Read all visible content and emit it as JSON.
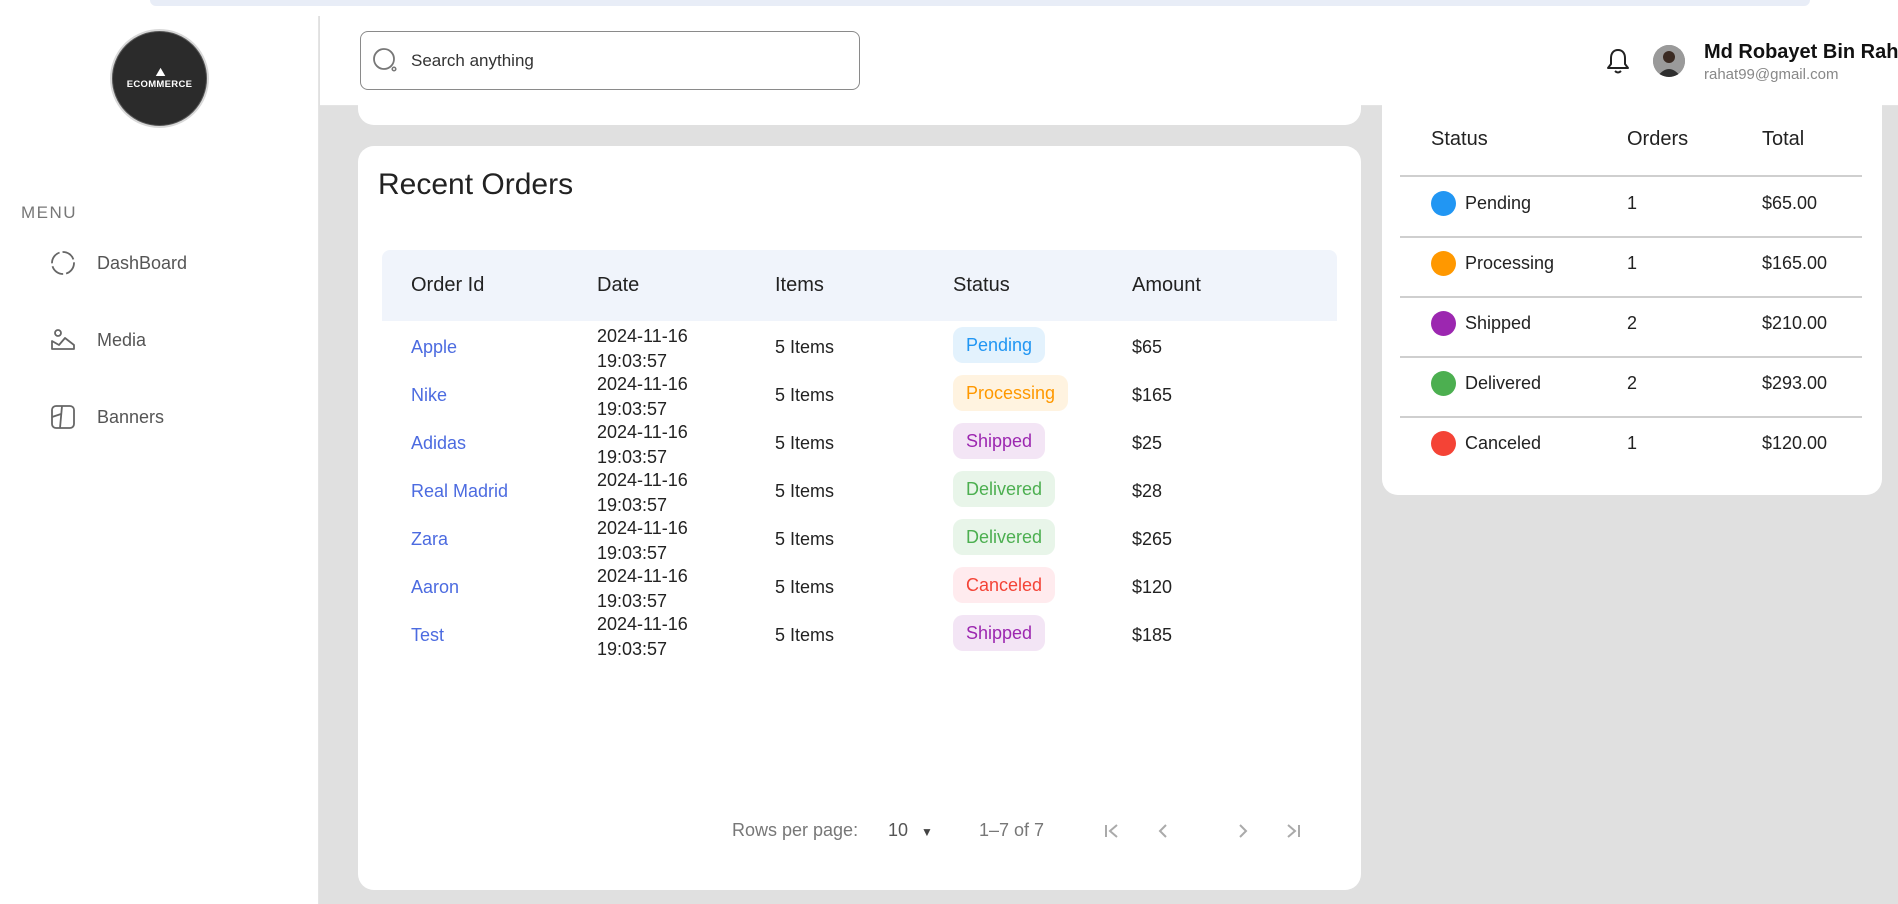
{
  "app": {
    "logo_text": "ECOMMERCE"
  },
  "sidebar": {
    "menu_title": "MENU",
    "items": [
      {
        "label": "DashBoard",
        "icon": "dashboard-icon"
      },
      {
        "label": "Media",
        "icon": "media-icon"
      },
      {
        "label": "Banners",
        "icon": "banners-icon"
      }
    ]
  },
  "header": {
    "search_placeholder": "Search anything",
    "user_name": "Md Robayet Bin Rahat",
    "user_email": "rahat99@gmail.com"
  },
  "recent_orders": {
    "title": "Recent Orders",
    "columns": [
      "Order Id",
      "Date",
      "Items",
      "Status",
      "Amount"
    ],
    "rows": [
      {
        "order_id": "Apple",
        "date": "2024-11-16",
        "time": "19:03:57",
        "items": "5 Items",
        "status": "Pending",
        "amount": "$65"
      },
      {
        "order_id": "Nike",
        "date": "2024-11-16",
        "time": "19:03:57",
        "items": "5 Items",
        "status": "Processing",
        "amount": "$165"
      },
      {
        "order_id": "Adidas",
        "date": "2024-11-16",
        "time": "19:03:57",
        "items": "5 Items",
        "status": "Shipped",
        "amount": "$25"
      },
      {
        "order_id": "Real Madrid",
        "date": "2024-11-16",
        "time": "19:03:57",
        "items": "5 Items",
        "status": "Delivered",
        "amount": "$28"
      },
      {
        "order_id": "Zara",
        "date": "2024-11-16",
        "time": "19:03:57",
        "items": "5 Items",
        "status": "Delivered",
        "amount": "$265"
      },
      {
        "order_id": "Aaron",
        "date": "2024-11-16",
        "time": "19:03:57",
        "items": "5 Items",
        "status": "Canceled",
        "amount": "$120"
      },
      {
        "order_id": "Test",
        "date": "2024-11-16",
        "time": "19:03:57",
        "items": "5 Items",
        "status": "Shipped",
        "amount": "$185"
      }
    ],
    "pagination": {
      "rows_per_page_label": "Rows per page:",
      "rows_per_page": "10",
      "range": "1–7 of 7"
    }
  },
  "status_summary": {
    "columns": [
      "Status",
      "Orders",
      "Total"
    ],
    "rows": [
      {
        "status": "Pending",
        "orders": "1",
        "total": "$65.00",
        "color": "#2196f3"
      },
      {
        "status": "Processing",
        "orders": "1",
        "total": "$165.00",
        "color": "#ff9800"
      },
      {
        "status": "Shipped",
        "orders": "2",
        "total": "$210.00",
        "color": "#9c27b0"
      },
      {
        "status": "Delivered",
        "orders": "2",
        "total": "$293.00",
        "color": "#4caf50"
      },
      {
        "status": "Canceled",
        "orders": "1",
        "total": "$120.00",
        "color": "#f44336"
      }
    ]
  },
  "status_colors": {
    "Pending": {
      "fg": "#2196f3",
      "bg": "#e3f2fd"
    },
    "Processing": {
      "fg": "#ff9800",
      "bg": "#fff3e0"
    },
    "Shipped": {
      "fg": "#9c27b0",
      "bg": "#f3e5f5"
    },
    "Delivered": {
      "fg": "#4caf50",
      "bg": "#e8f5e9"
    },
    "Canceled": {
      "fg": "#f44336",
      "bg": "#ffebee"
    }
  }
}
